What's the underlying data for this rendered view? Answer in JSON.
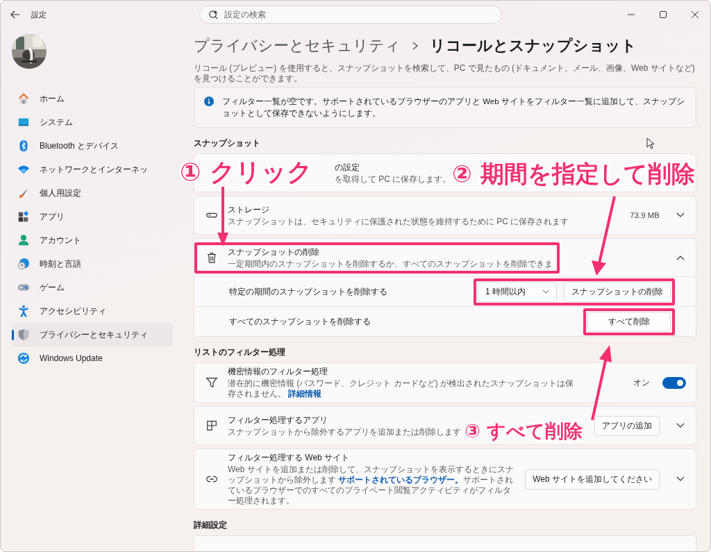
{
  "window": {
    "title": "設定"
  },
  "search": {
    "placeholder": "設定の検索"
  },
  "sidebar": {
    "items": [
      {
        "label": "ホーム",
        "selected": false
      },
      {
        "label": "システム",
        "selected": false
      },
      {
        "label": "Bluetooth とデバイス",
        "selected": false
      },
      {
        "label": "ネットワークとインターネッ",
        "selected": false
      },
      {
        "label": "個人用設定",
        "selected": false
      },
      {
        "label": "アプリ",
        "selected": false
      },
      {
        "label": "アカウント",
        "selected": false
      },
      {
        "label": "時刻と言語",
        "selected": false
      },
      {
        "label": "ゲーム",
        "selected": false
      },
      {
        "label": "アクセシビリティ",
        "selected": false
      },
      {
        "label": "プライバシーとセキュリティ",
        "selected": true
      },
      {
        "label": "Windows Update",
        "selected": false
      }
    ]
  },
  "breadcrumb": [
    "プライバシーとセキュリティ",
    "リコールとスナップショット"
  ],
  "description": "リコール (プレビュー) を使用すると、スナップショットを検索して、PC で見たもの (ドキュメント、メール、画像、Web サイトなど) を見つけることができます。",
  "info": "フィルター一覧が空です。サポートされているブラウザーのアプリと Web サイトをフィルター一覧に追加して、スナップショットとして保存できないようにします。",
  "sections": [
    {
      "heading": "スナップショット",
      "rows": [
        {
          "kind": "partial",
          "title": "の設定",
          "description": "を取得して PC に保存します。"
        },
        {
          "kind": "expander",
          "title": "ストレージ",
          "description": "スナップショットは、セキュリティに保護された状態を維持するために PC に保存されます",
          "value": "73.9 MB",
          "expanded": false
        },
        {
          "kind": "expander",
          "title": "スナップショットの削除",
          "description": "一定期間内のスナップショットを削除するか、すべてのスナップショットを削除できま",
          "expanded": true,
          "subrows": [
            {
              "label": "特定の期間のスナップショットを削除する",
              "dropdown": "1 時間以内",
              "button": "スナップショットの削除"
            },
            {
              "label": "すべてのスナップショットを削除する",
              "button": "すべて削除"
            }
          ]
        }
      ]
    },
    {
      "heading": "リストのフィルター処理",
      "rows": [
        {
          "kind": "toggle",
          "title": "機密情報のフィルター処理",
          "description": "潜在的に機密情報 (パスワード、クレジット カードなど) が検出されたスナップショットは保存されません。",
          "link": "詳細情報",
          "value": "オン",
          "on": true
        },
        {
          "kind": "expander",
          "title": "フィルター処理するアプリ",
          "description": "スナップショットから除外するアプリを追加または削除します",
          "button": "アプリの追加",
          "expanded": false
        },
        {
          "kind": "expander",
          "title": "フィルター処理する Web サイト",
          "description": "Web サイトを追加または削除して、スナップショットを表示するときにスナップショットから除外します",
          "link": "サポートされているブラウザー。",
          "description_after": "サポートされているブラウザーでのすべてのプライベート閲覧アクティビティがフィルター処理されます。",
          "button": "Web サイトを追加してください",
          "expanded": false
        }
      ]
    },
    {
      "heading": "詳細設定",
      "card_partly_visible": true
    }
  ],
  "annotations": [
    {
      "text": "① クリック"
    },
    {
      "text": "② 期間を指定して削除"
    },
    {
      "text": "③ すべて削除"
    }
  ]
}
